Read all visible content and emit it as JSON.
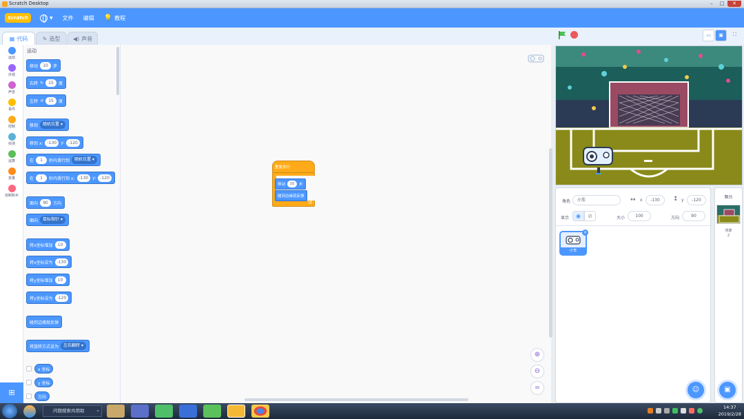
{
  "window": {
    "title": "Scratch Desktop"
  },
  "menubar": {
    "logo": "Scratch",
    "file": "文件",
    "edit": "编辑",
    "tutorials": "教程"
  },
  "tabs": {
    "code": "代码",
    "costumes": "造型",
    "sounds": "声音"
  },
  "categories": [
    {
      "label": "运动",
      "color": "#4c97ff"
    },
    {
      "label": "外观",
      "color": "#9966ff"
    },
    {
      "label": "声音",
      "color": "#cf63cf"
    },
    {
      "label": "事件",
      "color": "#ffbf00"
    },
    {
      "label": "控制",
      "color": "#ffab19"
    },
    {
      "label": "侦测",
      "color": "#5cb1d6"
    },
    {
      "label": "运算",
      "color": "#59c059"
    },
    {
      "label": "变量",
      "color": "#ff8c1a"
    },
    {
      "label": "自制积木",
      "color": "#ff6680"
    }
  ],
  "palette": {
    "section": "运动",
    "move": {
      "a": "移动",
      "v": "10",
      "b": "步"
    },
    "turn_right": {
      "a": "右转",
      "v": "15",
      "b": "度"
    },
    "turn_left": {
      "a": "左转",
      "v": "15",
      "b": "度"
    },
    "goto": {
      "a": "移到",
      "dd": "随机位置"
    },
    "goto_xy": {
      "a": "移到 x:",
      "x": "-130",
      "y_label": "y:",
      "y": "-120"
    },
    "glide": {
      "a": "在",
      "v": "1",
      "b": "秒内滑行到",
      "dd": "随机位置"
    },
    "glide_xy": {
      "a": "在",
      "v": "1",
      "b": "秒内滑行到 x:",
      "x": "-130",
      "y_label": "y:",
      "y": "-120"
    },
    "point_dir": {
      "a": "面向",
      "v": "90",
      "b": "方向"
    },
    "point_towards": {
      "a": "面向",
      "dd": "鼠标指针"
    },
    "change_x": {
      "a": "将x坐标增加",
      "v": "10"
    },
    "set_x": {
      "a": "将x坐标设为",
      "v": "-130"
    },
    "change_y": {
      "a": "将y坐标增加",
      "v": "10"
    },
    "set_y": {
      "a": "将y坐标设为",
      "v": "-120"
    },
    "bounce": "碰到边缘就反弹",
    "rotation": {
      "a": "将旋转方式设为",
      "dd": "左右翻转"
    },
    "x_pos": "x 坐标",
    "y_pos": "y 坐标",
    "direction": "方向"
  },
  "script": {
    "hat": "重复执行",
    "move": {
      "a": "移动",
      "v": "10",
      "b": "步"
    },
    "bounce": "碰到边缘就反弹"
  },
  "sprite_info": {
    "sprite_label": "角色",
    "sprite_name": "小车",
    "x_label": "x",
    "x": "-130",
    "y_label": "y",
    "y": "-120",
    "show_label": "显示",
    "size_label": "大小",
    "size": "100",
    "direction_label": "方向",
    "direction": "90"
  },
  "sprites": [
    {
      "name": "小车"
    }
  ],
  "stage_pane": {
    "title": "舞台",
    "backdrops_label": "背景",
    "backdrops_count": "2"
  },
  "taskbar": {
    "search_placeholder": "问题搜索共用助",
    "time": "14:37",
    "date": "2019/2/28"
  }
}
